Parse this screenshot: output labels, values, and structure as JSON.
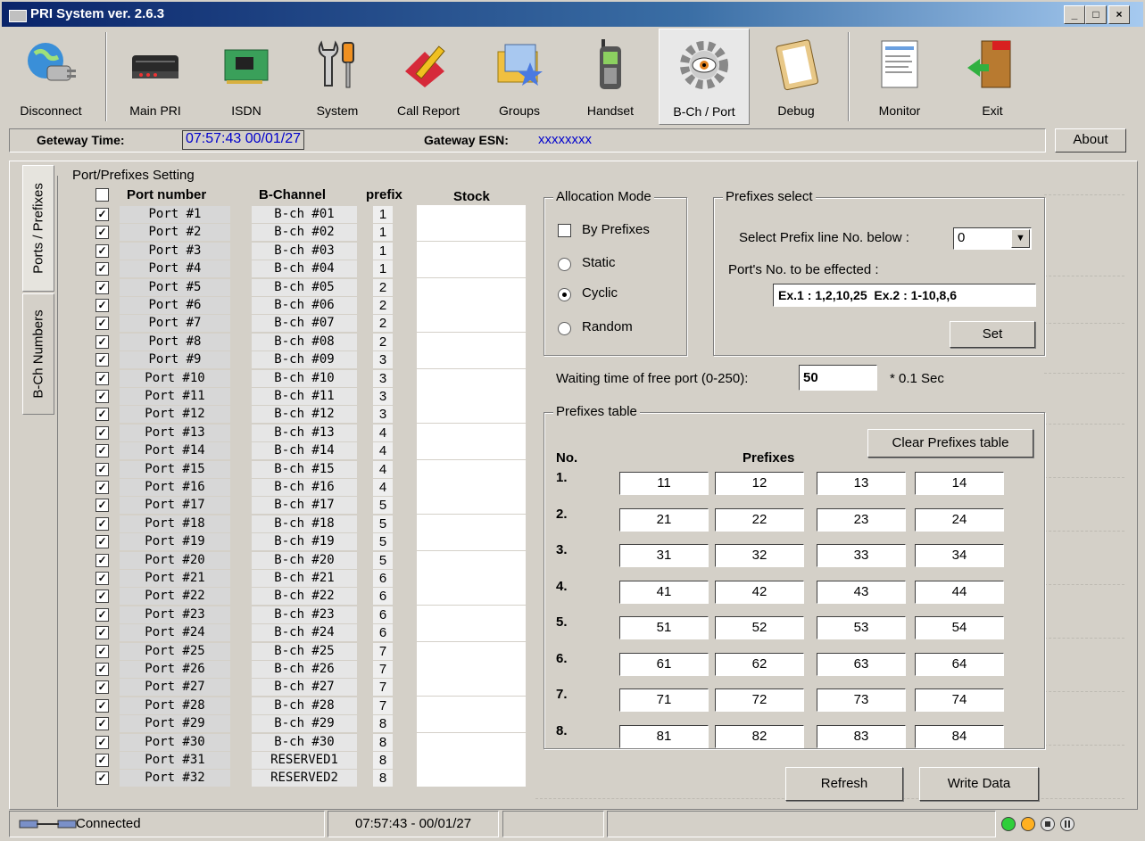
{
  "window": {
    "title": "PRI System ver. 2.6.3"
  },
  "toolbar": {
    "items": [
      {
        "label": "Disconnect",
        "icon": "disconnect-plug-icon"
      },
      {
        "label": "Main PRI",
        "icon": "router-icon"
      },
      {
        "label": "ISDN",
        "icon": "isdn-card-icon"
      },
      {
        "label": "System",
        "icon": "tools-icon"
      },
      {
        "label": "Call Report",
        "icon": "report-pen-icon"
      },
      {
        "label": "Groups",
        "icon": "groups-folder-icon"
      },
      {
        "label": "Handset",
        "icon": "handset-icon"
      },
      {
        "label": "B-Ch / Port",
        "icon": "gear-eye-icon"
      },
      {
        "label": "Debug",
        "icon": "clipboard-icon"
      },
      {
        "label": "Monitor",
        "icon": "monitor-doc-icon"
      },
      {
        "label": "Exit",
        "icon": "exit-door-icon"
      }
    ]
  },
  "gateway": {
    "time_label": "Geteway Time:",
    "time_value": "07:57:43",
    "date_value": "00/01/27",
    "esn_label": "Gateway ESN:",
    "esn_value": "xxxxxxxx",
    "about_label": "About"
  },
  "tabs": {
    "ports_prefixes": "Ports / Prefixes",
    "bch_numbers": "B-Ch Numbers"
  },
  "port_group": {
    "title": "Port/Prefixes Setting",
    "headers": {
      "port": "Port number",
      "bch": "B-Channel",
      "prefix": "prefix",
      "stock": "Stock"
    },
    "rows": [
      {
        "port": "Port #1",
        "bch": "B-ch #01",
        "prefix": "1"
      },
      {
        "port": "Port #2",
        "bch": "B-ch #02",
        "prefix": "1"
      },
      {
        "port": "Port #3",
        "bch": "B-ch #03",
        "prefix": "1"
      },
      {
        "port": "Port #4",
        "bch": "B-ch #04",
        "prefix": "1"
      },
      {
        "port": "Port #5",
        "bch": "B-ch #05",
        "prefix": "2"
      },
      {
        "port": "Port #6",
        "bch": "B-ch #06",
        "prefix": "2"
      },
      {
        "port": "Port #7",
        "bch": "B-ch #07",
        "prefix": "2"
      },
      {
        "port": "Port #8",
        "bch": "B-ch #08",
        "prefix": "2"
      },
      {
        "port": "Port #9",
        "bch": "B-ch #09",
        "prefix": "3"
      },
      {
        "port": "Port #10",
        "bch": "B-ch #10",
        "prefix": "3"
      },
      {
        "port": "Port #11",
        "bch": "B-ch #11",
        "prefix": "3"
      },
      {
        "port": "Port #12",
        "bch": "B-ch #12",
        "prefix": "3"
      },
      {
        "port": "Port #13",
        "bch": "B-ch #13",
        "prefix": "4"
      },
      {
        "port": "Port #14",
        "bch": "B-ch #14",
        "prefix": "4"
      },
      {
        "port": "Port #15",
        "bch": "B-ch #15",
        "prefix": "4"
      },
      {
        "port": "Port #16",
        "bch": "B-ch #16",
        "prefix": "4"
      },
      {
        "port": "Port #17",
        "bch": "B-ch #17",
        "prefix": "5"
      },
      {
        "port": "Port #18",
        "bch": "B-ch #18",
        "prefix": "5"
      },
      {
        "port": "Port #19",
        "bch": "B-ch #19",
        "prefix": "5"
      },
      {
        "port": "Port #20",
        "bch": "B-ch #20",
        "prefix": "5"
      },
      {
        "port": "Port #21",
        "bch": "B-ch #21",
        "prefix": "6"
      },
      {
        "port": "Port #22",
        "bch": "B-ch #22",
        "prefix": "6"
      },
      {
        "port": "Port #23",
        "bch": "B-ch #23",
        "prefix": "6"
      },
      {
        "port": "Port #24",
        "bch": "B-ch #24",
        "prefix": "6"
      },
      {
        "port": "Port #25",
        "bch": "B-ch #25",
        "prefix": "7"
      },
      {
        "port": "Port #26",
        "bch": "B-ch #26",
        "prefix": "7"
      },
      {
        "port": "Port #27",
        "bch": "B-ch #27",
        "prefix": "7"
      },
      {
        "port": "Port #28",
        "bch": "B-ch #28",
        "prefix": "7"
      },
      {
        "port": "Port #29",
        "bch": "B-ch #29",
        "prefix": "8"
      },
      {
        "port": "Port #30",
        "bch": "B-ch #30",
        "prefix": "8"
      },
      {
        "port": "Port #31",
        "bch": "RESERVED1",
        "prefix": "8"
      },
      {
        "port": "Port #32",
        "bch": "RESERVED2",
        "prefix": "8"
      }
    ]
  },
  "allocation": {
    "title": "Allocation Mode",
    "by_prefixes": "By Prefixes",
    "options": [
      "Static",
      "Cyclic",
      "Random"
    ],
    "selected": "Cyclic"
  },
  "prefix_select": {
    "title": "Prefixes select",
    "select_label": "Select Prefix line No. below :",
    "select_value": "0",
    "ports_label": "Port's No. to be effected :",
    "ports_value": "Ex.1 : 1,2,10,25  Ex.2 : 1-10,8,6",
    "set_label": "Set"
  },
  "waiting": {
    "label": "Waiting time of free port (0-250):",
    "value": "50",
    "unit": "* 0.1 Sec"
  },
  "prefix_table": {
    "title": "Prefixes table",
    "clear_label": "Clear Prefixes table",
    "no_header": "No.",
    "prefixes_header": "Prefixes",
    "rows": [
      {
        "no": "1.",
        "values": [
          "11",
          "12",
          "13",
          "14"
        ]
      },
      {
        "no": "2.",
        "values": [
          "21",
          "22",
          "23",
          "24"
        ]
      },
      {
        "no": "3.",
        "values": [
          "31",
          "32",
          "33",
          "34"
        ]
      },
      {
        "no": "4.",
        "values": [
          "41",
          "42",
          "43",
          "44"
        ]
      },
      {
        "no": "5.",
        "values": [
          "51",
          "52",
          "53",
          "54"
        ]
      },
      {
        "no": "6.",
        "values": [
          "61",
          "62",
          "63",
          "64"
        ]
      },
      {
        "no": "7.",
        "values": [
          "71",
          "72",
          "73",
          "74"
        ]
      },
      {
        "no": "8.",
        "values": [
          "81",
          "82",
          "83",
          "84"
        ]
      }
    ]
  },
  "actions": {
    "refresh": "Refresh",
    "write": "Write Data"
  },
  "statusbar": {
    "connection": "Connected",
    "datetime": "07:57:43 - 00/01/27"
  },
  "colors": {
    "accent_blue": "#0000cc",
    "led_green": "#2fcf3a",
    "led_orange": "#ffb020"
  }
}
